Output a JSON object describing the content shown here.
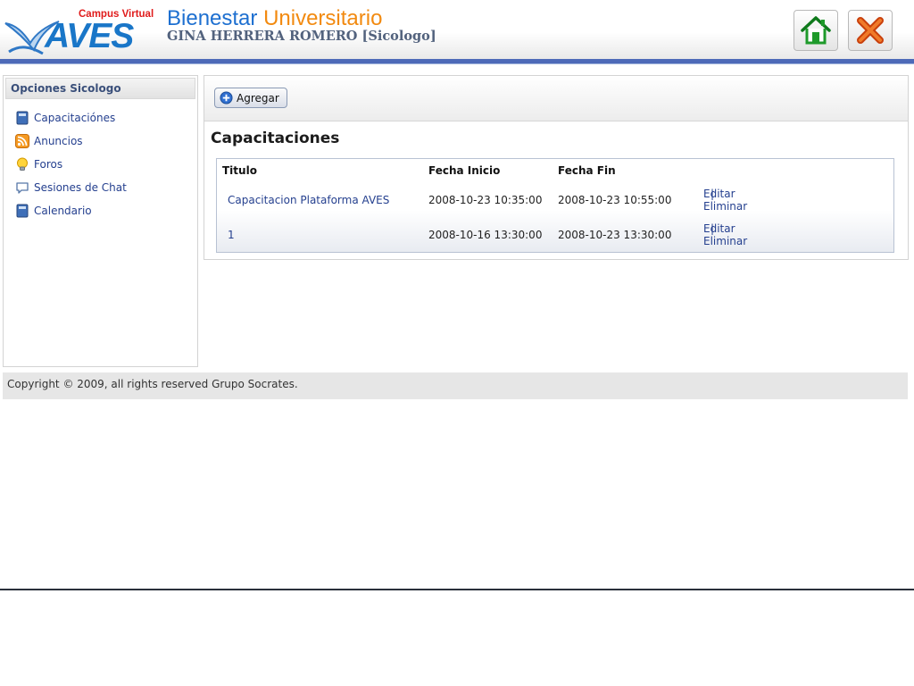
{
  "header": {
    "logo_tag": "Campus Virtual",
    "logo_name": "AVES",
    "title_part1": "Bienestar",
    "title_part2": "Universitario",
    "user_line": "GINA HERRERA ROMERO [Sicologo]",
    "home_icon": "home-icon",
    "close_icon": "close-icon"
  },
  "sidebar": {
    "heading": "Opciones Sicologo",
    "items": [
      {
        "label": "Capacitaciónes",
        "icon": "book-icon"
      },
      {
        "label": "Anuncios",
        "icon": "rss-icon"
      },
      {
        "label": "Foros",
        "icon": "lightbulb-icon"
      },
      {
        "label": "Sesiones de Chat",
        "icon": "chat-bubble-icon"
      },
      {
        "label": "Calendario",
        "icon": "book-icon"
      }
    ]
  },
  "main": {
    "add_label": "Agregar",
    "section_title": "Capacitaciones",
    "columns": [
      "Titulo",
      "Fecha Inicio",
      "Fecha Fin"
    ],
    "rows": [
      {
        "title": "Capacitacion Plataforma AVES",
        "start": "2008-10-23 10:35:00",
        "end": "2008-10-23 10:55:00",
        "edit": "Editar",
        "sep": "|",
        "delete": "Eliminar"
      },
      {
        "title": "1",
        "start": "2008-10-16 13:30:00",
        "end": "2008-10-23 13:30:00",
        "edit": "Editar",
        "sep": "|",
        "delete": "Eliminar"
      }
    ]
  },
  "footer": {
    "copyright": "Copyright © 2009, all rights reserved Grupo Socrates."
  },
  "colors": {
    "header_rule": "#4d6ab8",
    "link": "#25408f",
    "title_blue": "#1d6fd0",
    "title_orange": "#f28a10",
    "logo_red": "#e01b1b"
  }
}
